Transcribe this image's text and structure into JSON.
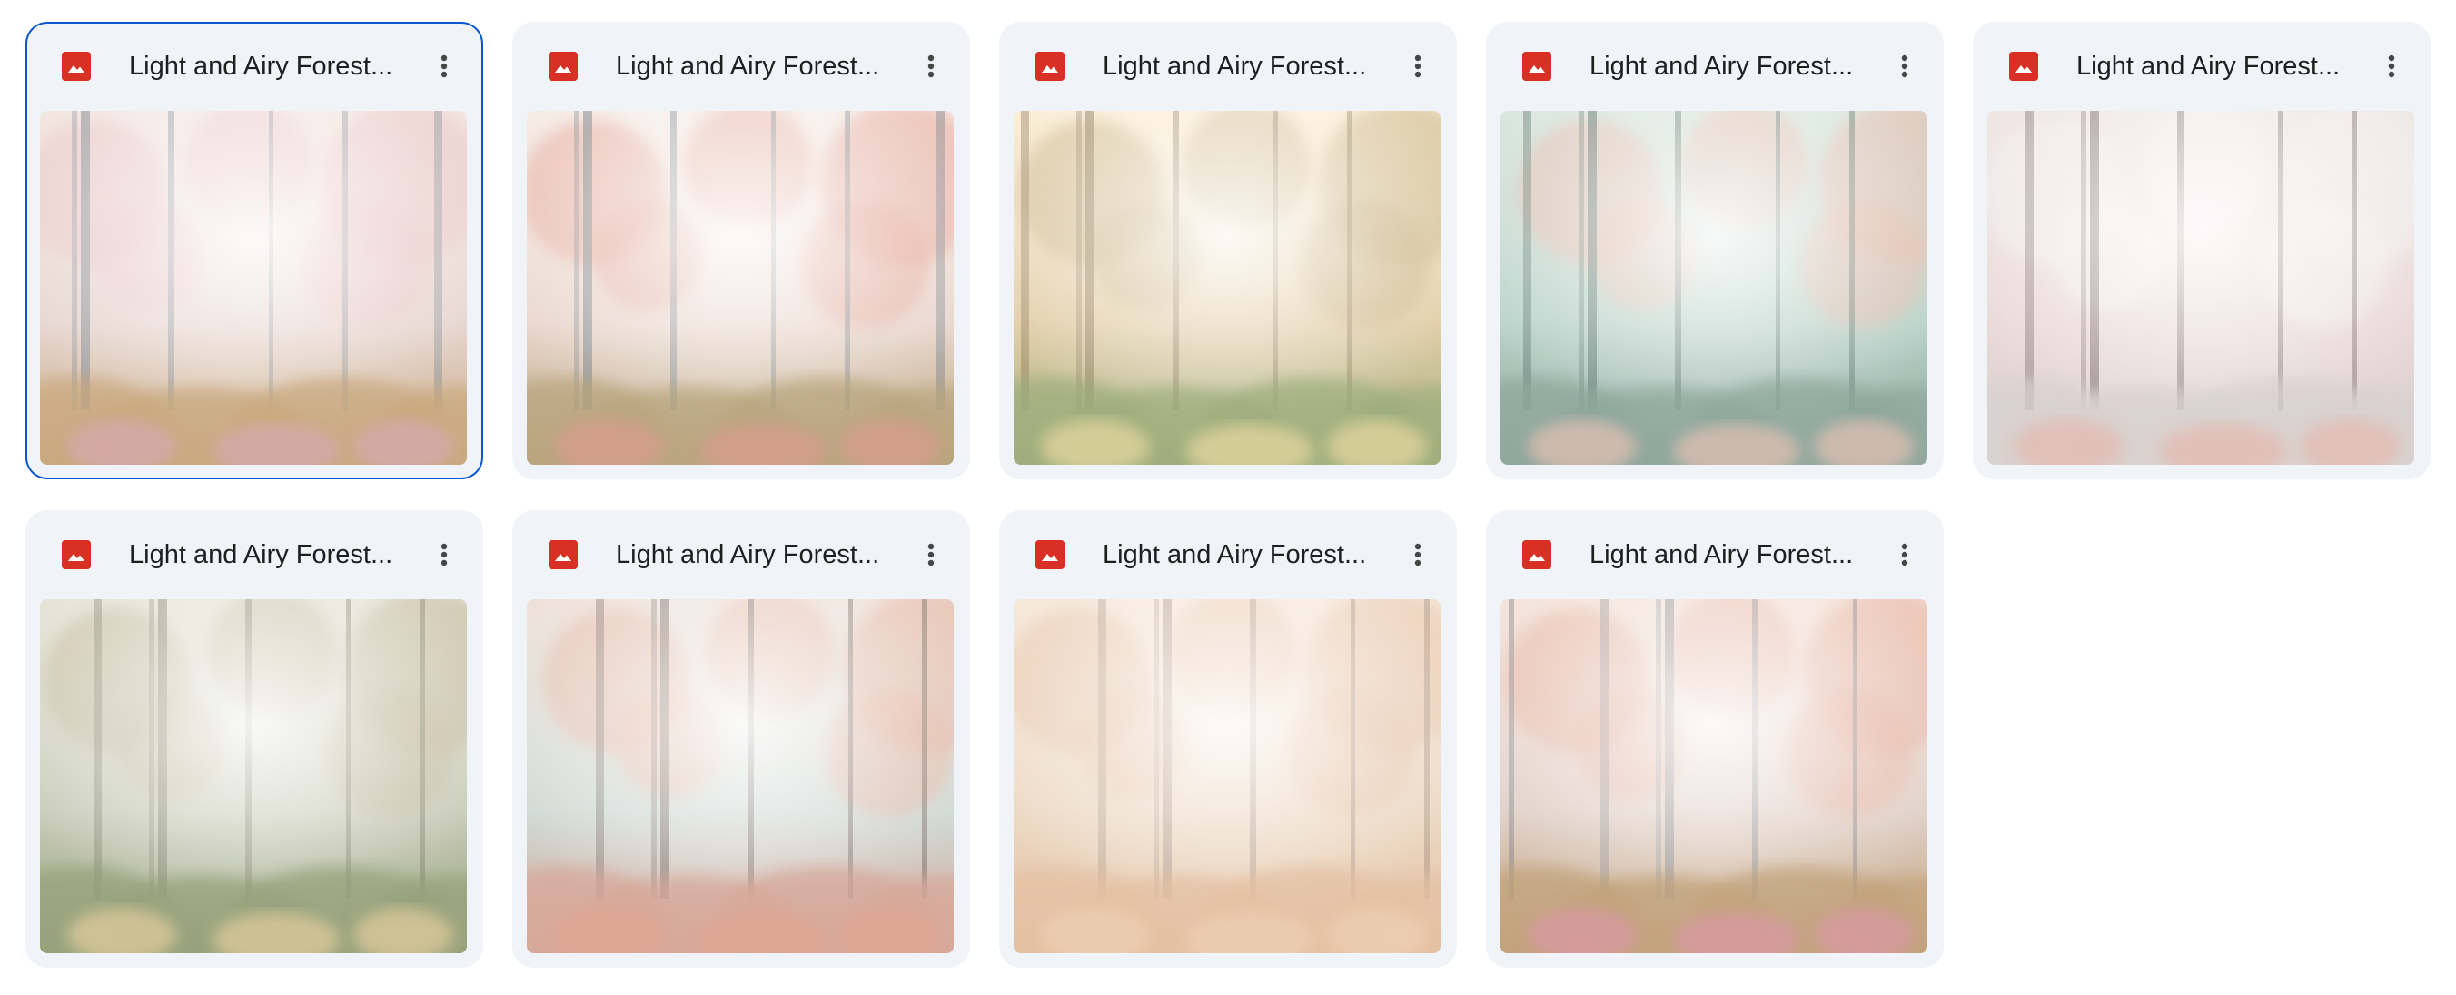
{
  "files": [
    {
      "name": "Light and Airy Forest...",
      "type_icon": "image-file-icon",
      "selected": true,
      "palette": {
        "sky": "#f3e7e2",
        "mid": "#e6d5cf",
        "ground": "#c9a97f",
        "accent": "#d8a9b3",
        "trunk": "#7f8790",
        "foliage": "#e9c4c4"
      }
    },
    {
      "name": "Light and Airy Forest...",
      "type_icon": "image-file-icon",
      "selected": false,
      "palette": {
        "sky": "#f6ece6",
        "mid": "#e9d6cc",
        "ground": "#b9a57e",
        "accent": "#dc9c8f",
        "trunk": "#6f7c86",
        "foliage": "#e5a697"
      }
    },
    {
      "name": "Light and Airy Forest...",
      "type_icon": "image-file-icon",
      "selected": false,
      "palette": {
        "sky": "#fbeed6",
        "mid": "#e2cda6",
        "ground": "#9fae7e",
        "accent": "#e9d9a0",
        "trunk": "#8a7458",
        "foliage": "#c9b486"
      }
    },
    {
      "name": "Light and Airy Forest...",
      "type_icon": "image-file-icon",
      "selected": false,
      "palette": {
        "sky": "#d9e6df",
        "mid": "#b8d2c8",
        "ground": "#8fa79d",
        "accent": "#e7c2b4",
        "trunk": "#4f6a61",
        "foliage": "#e6b8a6"
      }
    },
    {
      "name": "Light and Airy Forest...",
      "type_icon": "image-file-icon",
      "selected": false,
      "palette": {
        "sky": "#efe6e2",
        "mid": "#e8d8d6",
        "ground": "#d9d2cf",
        "accent": "#e5b8ad",
        "trunk": "#6b5b58",
        "foliage": "#f3eeee"
      }
    },
    {
      "name": "Light and Airy Forest...",
      "type_icon": "image-file-icon",
      "selected": false,
      "palette": {
        "sky": "#e6e4d6",
        "mid": "#c8cbb8",
        "ground": "#97a27c",
        "accent": "#e5cf9f",
        "trunk": "#7a7a64",
        "foliage": "#c3b89a"
      }
    },
    {
      "name": "Light and Airy Forest...",
      "type_icon": "image-file-icon",
      "selected": false,
      "palette": {
        "sky": "#eee2da",
        "mid": "#cfd9d4",
        "ground": "#d7a89a",
        "accent": "#e2a58f",
        "trunk": "#6a5c58",
        "foliage": "#e6b49f"
      }
    },
    {
      "name": "Light and Airy Forest...",
      "type_icon": "image-file-icon",
      "selected": false,
      "palette": {
        "sky": "#f6e8da",
        "mid": "#ecd8c2",
        "ground": "#e4c1a3",
        "accent": "#efd0b4",
        "trunk": "#a38f82",
        "foliage": "#e7c4a8"
      }
    },
    {
      "name": "Light and Airy Forest...",
      "type_icon": "image-file-icon",
      "selected": false,
      "palette": {
        "sky": "#f4e4da",
        "mid": "#e0cfc6",
        "ground": "#c2a37c",
        "accent": "#dc98a8",
        "trunk": "#7d8088",
        "foliage": "#e6b09c"
      }
    }
  ],
  "more_icon": "more-vertical-icon",
  "accent_color": "#0b57d0",
  "image_icon_color": "#d93025"
}
